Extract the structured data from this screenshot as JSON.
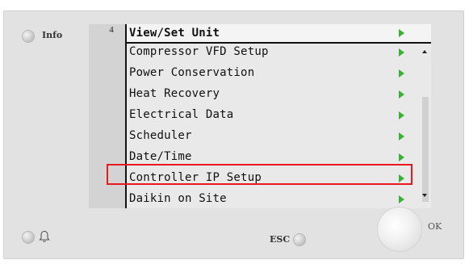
{
  "panel": {
    "info_label": "Info",
    "esc_label": "ESC",
    "ok_label": "OK"
  },
  "screen": {
    "page_number": "4",
    "title": "View/Set Unit",
    "menu_items": [
      {
        "label": "Compressor VFD Setup"
      },
      {
        "label": "Power Conservation"
      },
      {
        "label": "Heat Recovery"
      },
      {
        "label": "Electrical Data"
      },
      {
        "label": "Scheduler"
      },
      {
        "label": "Date/Time"
      },
      {
        "label": "Controller IP Setup",
        "highlighted": true
      },
      {
        "label": "Daikin on Site"
      }
    ]
  },
  "colors": {
    "arrow": "#39b037",
    "highlight": "#e8191f",
    "frame": "#e2e2e2",
    "screen": "#e9e9e9"
  },
  "icons": {
    "info_led": "led-indicator",
    "alarm": "bell-icon",
    "esc_led": "led-indicator",
    "row_arrow": "arrow-right-icon",
    "scroll_up": "scroll-up-icon",
    "scroll_down": "scroll-down-icon"
  }
}
